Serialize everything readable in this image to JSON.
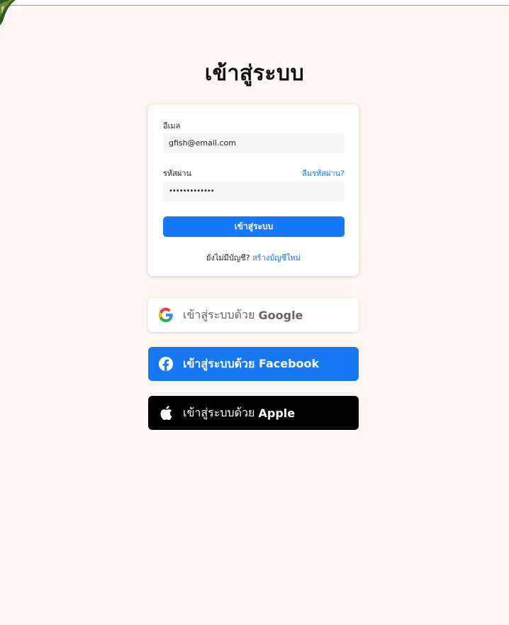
{
  "login": {
    "title": "เข้าสู่ระบบ",
    "email_label": "อีเมล",
    "email_value": "gfish@email.com",
    "password_label": "รหัสผ่าน",
    "forgot_link": "ลืมรหัสผ่าน?",
    "password_value": "•••••••••••••",
    "submit_label": "เข้าสู่ระบบ",
    "no_account": "ยังไม่มีบัญชี?",
    "create_account": "สร้างบัญชีใหม่"
  },
  "social": {
    "google_prefix": "เข้าสู่ระบบด้วย",
    "google_name": "Google",
    "facebook_label": "เข้าสู่ระบบด้วย Facebook",
    "apple_prefix": "เข้าสู่ระบบด้วย",
    "apple_name": "Apple"
  },
  "colors": {
    "accent": "#1677ff",
    "facebook": "#1877f2",
    "background": "#fdf8f1"
  },
  "icons": [
    "google-icon",
    "facebook-icon",
    "apple-icon",
    "leaf-decoration"
  ]
}
